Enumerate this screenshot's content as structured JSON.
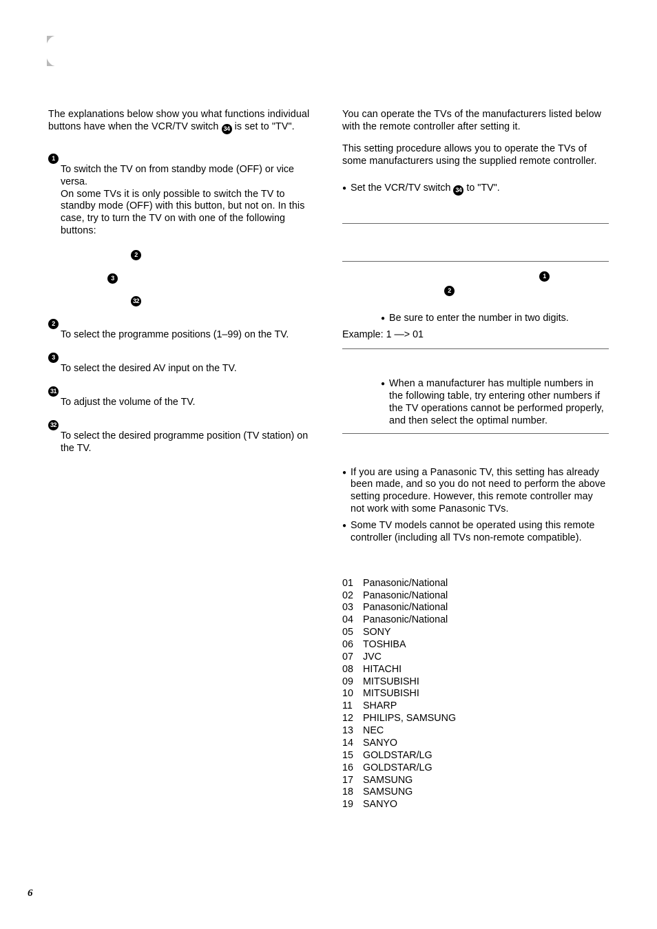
{
  "page_number": "6",
  "left": {
    "intro_a": "The explanations below show you what functions individual buttons have when the VCR/TV switch ",
    "intro_switch_num": "34",
    "intro_b": " is set to \"TV\".",
    "buttons": {
      "b1": {
        "num": "1",
        "desc_a": "To switch the TV on from standby mode (OFF) or vice versa.",
        "desc_b": "On some TVs it is only possible to switch the TV to standby mode (OFF) with this button, but not on. In this case, try to turn the TV on with one of the following buttons:",
        "ref2": "2",
        "ref3": "3",
        "ref32": "32"
      },
      "b2": {
        "num": "2",
        "desc": "To select the programme positions (1–99) on the TV."
      },
      "b3": {
        "num": "3",
        "desc": "To select the desired AV input on the TV."
      },
      "b31": {
        "num": "31",
        "desc": "To adjust the volume of the TV."
      },
      "b32": {
        "num": "32",
        "desc": "To select the desired programme position (TV station) on the TV."
      }
    }
  },
  "right": {
    "intro1": "You can operate the TVs of the manufacturers listed below with the remote controller after setting it.",
    "intro2": "This setting procedure allows you to operate the TVs of some manufacturers using the supplied remote controller.",
    "bullet_set_a": "Set the VCR/TV switch ",
    "bullet_set_num": "34",
    "bullet_set_b": " to \"TV\".",
    "step_ref1": "1",
    "step_ref2": "2",
    "step_note_a": "Be sure to enter the number in two digits.",
    "step_note_example": "Example: 1 —> 01",
    "midnote": "When a manufacturer has multiple numbers in the following table, try entering other numbers if the TV operations cannot be performed properly, and then select the optimal number.",
    "note1": "If you are using a Panasonic TV, this setting has already been made, and so you do not need to perform the above setting procedure. However, this remote controller may not work with some Panasonic TVs.",
    "note2": "Some TV models cannot be operated using this remote controller (including all TVs non-remote compatible).",
    "manufacturers": [
      {
        "code": "01",
        "name": "Panasonic/National"
      },
      {
        "code": "02",
        "name": "Panasonic/National"
      },
      {
        "code": "03",
        "name": "Panasonic/National"
      },
      {
        "code": "04",
        "name": "Panasonic/National"
      },
      {
        "code": "05",
        "name": "SONY"
      },
      {
        "code": "06",
        "name": "TOSHIBA"
      },
      {
        "code": "07",
        "name": "JVC"
      },
      {
        "code": "08",
        "name": "HITACHI"
      },
      {
        "code": "09",
        "name": "MITSUBISHI"
      },
      {
        "code": "10",
        "name": "MITSUBISHI"
      },
      {
        "code": "11",
        "name": "SHARP"
      },
      {
        "code": "12",
        "name": "PHILIPS, SAMSUNG"
      },
      {
        "code": "13",
        "name": "NEC"
      },
      {
        "code": "14",
        "name": "SANYO"
      },
      {
        "code": "15",
        "name": "GOLDSTAR/LG"
      },
      {
        "code": "16",
        "name": "GOLDSTAR/LG"
      },
      {
        "code": "17",
        "name": "SAMSUNG"
      },
      {
        "code": "18",
        "name": "SAMSUNG"
      },
      {
        "code": "19",
        "name": "SANYO"
      }
    ]
  }
}
